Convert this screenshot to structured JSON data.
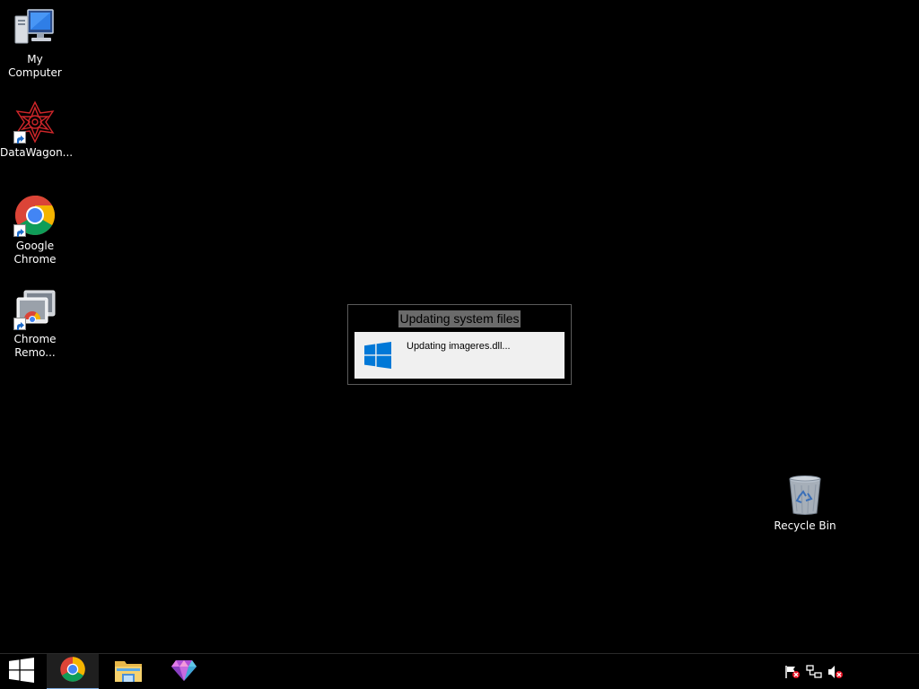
{
  "desktop": {
    "icons": [
      {
        "label": "My Computer",
        "icon": "computer-icon"
      },
      {
        "label": "DataWagon...",
        "icon": "datawagon-icon"
      },
      {
        "label": "Google Chrome",
        "icon": "chrome-icon"
      },
      {
        "label": "Chrome Remo...",
        "icon": "chrome-remote-desktop-icon"
      },
      {
        "label": "Recycle Bin",
        "icon": "recycle-bin-icon"
      }
    ]
  },
  "dialog": {
    "title": "Updating system files",
    "message": "Updating imageres.dll...",
    "icon": "windows-logo-icon"
  },
  "taskbar": {
    "items": [
      {
        "name": "start-button",
        "icon": "windows-logo-icon"
      },
      {
        "name": "chrome",
        "icon": "chrome-icon",
        "active": true
      },
      {
        "name": "file-explorer",
        "icon": "folder-icon"
      },
      {
        "name": "gem-app",
        "icon": "gem-icon"
      }
    ],
    "tray": [
      {
        "name": "action-center",
        "icon": "flag-icon"
      },
      {
        "name": "network",
        "icon": "network-icon"
      },
      {
        "name": "volume",
        "icon": "volume-muted-icon"
      }
    ]
  },
  "colors": {
    "desktop_bg": "#000000",
    "windows_blue": "#0078d7",
    "dialog_title_bg": "#6b6b6b",
    "dialog_body_bg": "#f0f0f0"
  }
}
